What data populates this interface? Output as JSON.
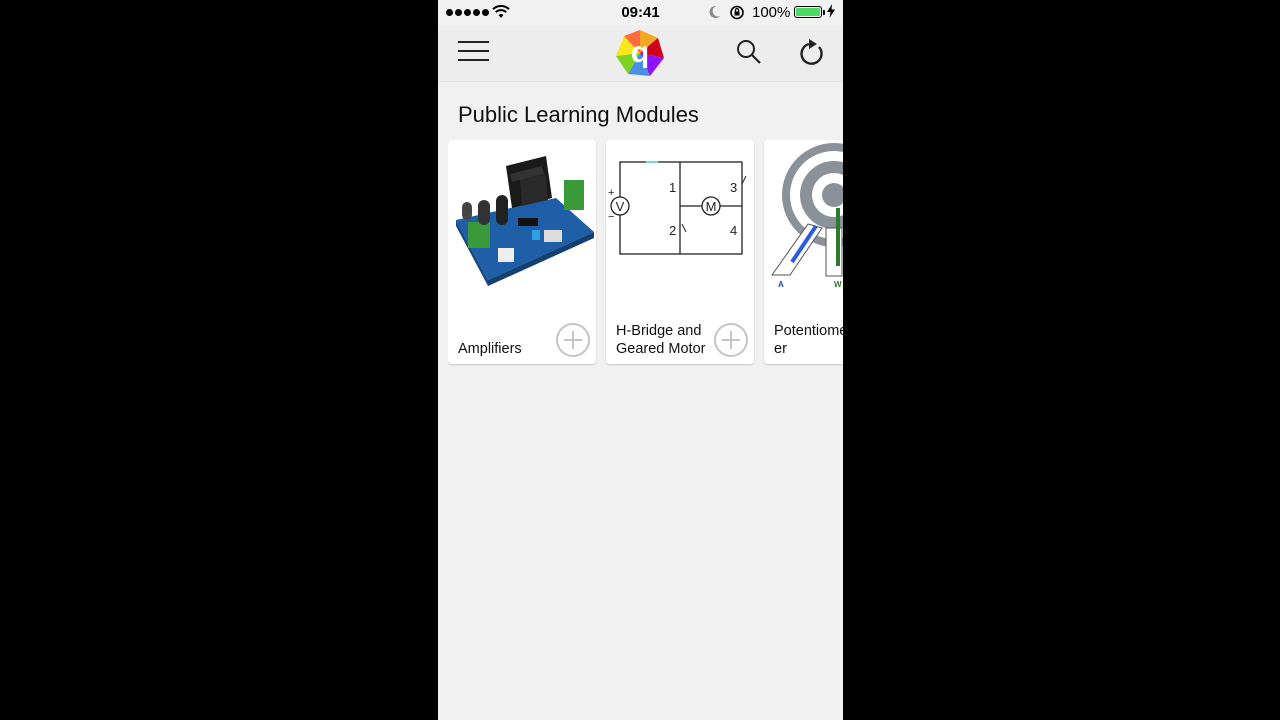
{
  "status_bar": {
    "time": "09:41",
    "battery_percent": "100%",
    "battery_level": 1.0,
    "icons": [
      "signal-dots-icon",
      "wifi-icon",
      "moon-icon",
      "rotation-lock-icon",
      "battery-icon",
      "charging-bolt-icon"
    ]
  },
  "navbar": {
    "menu_icon": "hamburger-menu-icon",
    "logo_letter": "q",
    "search_icon": "search-icon",
    "refresh_icon": "refresh-icon"
  },
  "section": {
    "title": "Public Learning Modules"
  },
  "modules": [
    {
      "label": "Amplifiers",
      "thumbnail": "amplifier-board-image"
    },
    {
      "label": "H-Bridge and Geared Motor",
      "thumbnail": "h-bridge-circuit-diagram",
      "diagram": {
        "v": "V",
        "m": "M",
        "plus": "+",
        "minus": "−",
        "s1": "1",
        "s2": "2",
        "s3": "3",
        "s4": "4"
      }
    },
    {
      "label": "Potentiometer",
      "thumbnail": "potentiometer-diagram",
      "diagram": {
        "a": "A",
        "w": "W"
      }
    }
  ],
  "colors": {
    "background": "#f1f1f1",
    "navbar": "#ededed",
    "battery_fill": "#4cd964",
    "add_button": "#c4c4c4"
  }
}
